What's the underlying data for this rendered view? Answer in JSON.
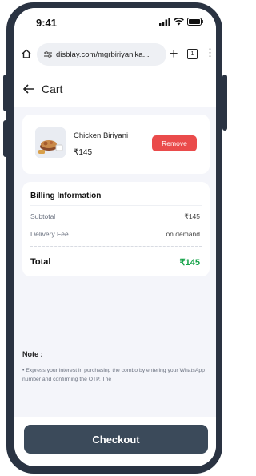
{
  "status_bar": {
    "time": "9:41"
  },
  "browser": {
    "url": "disblay.com/mgrbiriyanika...",
    "tab_count": "1"
  },
  "header": {
    "title": "Cart"
  },
  "cart_item": {
    "name": "Chicken Biriyani",
    "price": "₹145",
    "remove_label": "Remove"
  },
  "billing": {
    "title": "Billing Information",
    "subtotal_label": "Subtotal",
    "subtotal_value": "₹145",
    "delivery_label": "Delivery Fee",
    "delivery_value": "on demand",
    "total_label": "Total",
    "total_value": "₹145"
  },
  "note": {
    "title": "Note :",
    "text": "• Express your interest in purchasing the combo by entering your WhatsApp number and confirming the OTP. The"
  },
  "checkout": {
    "label": "Checkout"
  },
  "colors": {
    "remove": "#ea4b4b",
    "total": "#17a34a",
    "checkout": "#3b4a5a",
    "phone_frame": "#2a3342"
  },
  "icons": [
    "signal-icon",
    "wifi-icon",
    "battery-icon",
    "home-icon",
    "tune-icon",
    "plus-icon",
    "tabs-icon",
    "more-icon",
    "back-arrow-icon"
  ]
}
